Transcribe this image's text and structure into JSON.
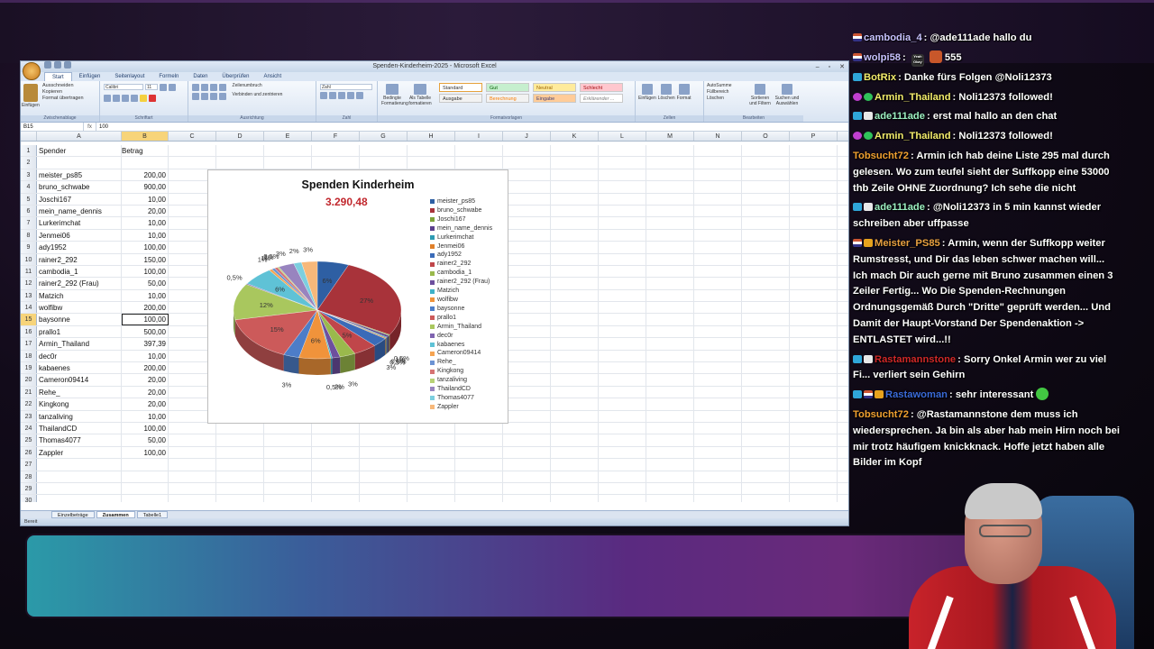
{
  "excel": {
    "window_title": "Spenden-Kinderheim-2025 - Microsoft Excel",
    "tabs": [
      "Start",
      "Einfügen",
      "Seitenlayout",
      "Formeln",
      "Daten",
      "Überprüfen",
      "Ansicht"
    ],
    "ribbon": {
      "paste": "Einfügen",
      "cut": "Ausschneiden",
      "copy": "Kopieren",
      "format_painter": "Format übertragen",
      "font": "Calibri",
      "font_size": "11",
      "wrap": "Zeilenumbruch",
      "merge": "Verbinden und zentrieren",
      "number_format": "Zahl",
      "cond_format": "Bedingte Formatierung",
      "as_table": "Als Tabelle formatieren",
      "groups": [
        "Zwischenablage",
        "Schriftart",
        "Ausrichtung",
        "Zahl",
        "Formatvorlagen",
        "Zellen",
        "Bearbeiten"
      ],
      "styles": [
        "Standard",
        "Gut",
        "Neutral",
        "Schlecht",
        "Ausgabe",
        "Berechnung",
        "Eingabe",
        "Erklärender ..."
      ],
      "cells": [
        "Einfügen",
        "Löschen",
        "Format"
      ],
      "editing": [
        "AutoSumme",
        "Füllbereich",
        "Löschen",
        "Sortieren und Filtern",
        "Suchen und Auswählen"
      ]
    },
    "name_box": "B15",
    "formula_value": "100",
    "columns": [
      "A",
      "B",
      "C",
      "D",
      "E",
      "F",
      "G",
      "H",
      "I",
      "J",
      "K",
      "L",
      "M",
      "N",
      "O",
      "P"
    ],
    "headers": {
      "a": "Spender",
      "b": "Betrag"
    },
    "rows": [
      {
        "n": "1",
        "a": "Spender",
        "b": "Betrag"
      },
      {
        "n": "2",
        "a": "",
        "b": ""
      },
      {
        "n": "3",
        "a": "meister_ps85",
        "b": "200,00"
      },
      {
        "n": "4",
        "a": "bruno_schwabe",
        "b": "900,00"
      },
      {
        "n": "5",
        "a": "Joschi167",
        "b": "10,00"
      },
      {
        "n": "6",
        "a": "mein_name_dennis",
        "b": "20,00"
      },
      {
        "n": "7",
        "a": "Lurkerimchat",
        "b": "10,00"
      },
      {
        "n": "8",
        "a": "Jenmei06",
        "b": "10,00"
      },
      {
        "n": "9",
        "a": "ady1952",
        "b": "100,00"
      },
      {
        "n": "10",
        "a": "rainer2_292",
        "b": "150,00"
      },
      {
        "n": "11",
        "a": "cambodia_1",
        "b": "100,00"
      },
      {
        "n": "12",
        "a": "rainer2_292 (Frau)",
        "b": "50,00"
      },
      {
        "n": "13",
        "a": "Matzich",
        "b": "10,00"
      },
      {
        "n": "14",
        "a": "wolfibw",
        "b": "200,00"
      },
      {
        "n": "15",
        "a": "baysonne",
        "b": "100,00"
      },
      {
        "n": "16",
        "a": "prallo1",
        "b": "500,00"
      },
      {
        "n": "17",
        "a": "Armin_Thailand",
        "b": "397,39"
      },
      {
        "n": "18",
        "a": "dec0r",
        "b": "10,00"
      },
      {
        "n": "19",
        "a": "kabaenes",
        "b": "200,00"
      },
      {
        "n": "20",
        "a": "Cameron09414",
        "b": "20,00"
      },
      {
        "n": "21",
        "a": "Rehe_",
        "b": "20,00"
      },
      {
        "n": "22",
        "a": "Kingkong",
        "b": "20,00"
      },
      {
        "n": "23",
        "a": "tanzaliving",
        "b": "10,00"
      },
      {
        "n": "24",
        "a": "ThailandCD",
        "b": "100,00"
      },
      {
        "n": "25",
        "a": "Thomas4077",
        "b": "50,00"
      },
      {
        "n": "26",
        "a": "Zappler",
        "b": "100,00"
      },
      {
        "n": "27",
        "a": "",
        "b": ""
      },
      {
        "n": "28",
        "a": "",
        "b": ""
      },
      {
        "n": "29",
        "a": "",
        "b": ""
      },
      {
        "n": "30",
        "a": "",
        "b": ""
      }
    ],
    "sheet_tabs": [
      "Einzelbeträge",
      "Zusammen",
      "Tabelle1"
    ],
    "status": "Bereit"
  },
  "chart_data": {
    "type": "pie",
    "title": "Spenden Kinderheim",
    "subtitle": "3.290,48",
    "categories": [
      "meister_ps85",
      "bruno_schwabe",
      "Joschi167",
      "mein_name_dennis",
      "Lurkerimchat",
      "Jenmei06",
      "ady1952",
      "rainer2_292",
      "cambodia_1",
      "rainer2_292 (Frau)",
      "Matzich",
      "wolfibw",
      "baysonne",
      "prallo1",
      "Armin_Thailand",
      "dec0r",
      "kabaenes",
      "Cameron09414",
      "Rehe_",
      "Kingkong",
      "tanzaliving",
      "ThailandCD",
      "Thomas4077",
      "Zappler"
    ],
    "values": [
      200,
      900,
      10,
      20,
      10,
      10,
      100,
      150,
      100,
      50,
      10,
      200,
      100,
      500,
      397.39,
      10,
      200,
      20,
      20,
      20,
      10,
      100,
      50,
      100
    ],
    "colors": [
      "#2e5fa3",
      "#a8333a",
      "#7ea33a",
      "#5b3f8c",
      "#2d9bb3",
      "#e07f2a",
      "#3a6bb8",
      "#c0464a",
      "#9ab94c",
      "#6d4f9e",
      "#3fb2c9",
      "#f0933b",
      "#4d7dc8",
      "#cc5a5a",
      "#a9c75e",
      "#7f64b0",
      "#5fc2d6",
      "#f6a452",
      "#6c93d3",
      "#d67373",
      "#b8d276",
      "#9884bf",
      "#7ccfdf",
      "#f7b87a"
    ],
    "labels": [
      "6%",
      "27%",
      "0,5%",
      "1%",
      "0,5%",
      "0,5%",
      "3%",
      "5%",
      "3%",
      "2%",
      "0,5%",
      "6%",
      "3%",
      "15%",
      "12%",
      "0,5%",
      "6%",
      "1%",
      "1%",
      "1%",
      "0,5%",
      "3%",
      "2%",
      "3%"
    ],
    "legend": "right"
  },
  "chat": [
    {
      "name": "cambodia_4",
      "color": "#c8c2ff",
      "badges": [
        "b-flag"
      ],
      "text": "@ade111ade hallo du"
    },
    {
      "name": "wolpi58",
      "color": "#c8c2ff",
      "badges": [
        "b-flag"
      ],
      "text": "555",
      "emote": "Yeah Okay"
    },
    {
      "name": "BotRix",
      "color": "#f3ec6c",
      "badges": [
        "b-mod"
      ],
      "text": "Danke fürs Folgen @Noli12373"
    },
    {
      "name": "Armin_Thailand",
      "color": "#f3ec6c",
      "badges": [
        "b-vip",
        "b-check"
      ],
      "text": "Noli12373 followed!"
    },
    {
      "name": "ade111ade",
      "color": "#9cf0c2",
      "badges": [
        "b-mod",
        "b-sub"
      ],
      "text": "erst mal hallo an den chat"
    },
    {
      "name": "Armin_Thailand",
      "color": "#f3ec6c",
      "badges": [
        "b-vip",
        "b-check"
      ],
      "text": "Noli12373 followed!"
    },
    {
      "name": "Tobsucht72",
      "color": "#f0a030",
      "badges": [],
      "text": "Armin ich hab deine Liste 295 mal durch gelesen. Wo zum teufel sieht der Suffkopp eine 53000 thb Zeile OHNE Zuordnung? Ich sehe die nicht"
    },
    {
      "name": "ade111ade",
      "color": "#9cf0c2",
      "badges": [
        "b-mod",
        "b-sub"
      ],
      "text": "@Noli12373 in 5 min kannst wieder schreiben aber uffpasse"
    },
    {
      "name": "Meister_PS85",
      "color": "#e8a040",
      "badges": [
        "b-flag",
        "b-gift"
      ],
      "text": "Armin, wenn der Suffkopp weiter Rumstresst, und Dir das leben schwer machen will... Ich mach Dir auch gerne mit Bruno zusammen einen 3 Zeiler Fertig... Wo Die Spenden-Rechnungen Ordnungsgemäß Durch \"Dritte\" geprüft werden... Und Damit der Haupt-Vorstand Der Spendenaktion -> ENTLASTET wird...!!"
    },
    {
      "name": "Rastamannstone",
      "color": "#d02828",
      "badges": [
        "b-mod",
        "b-sub"
      ],
      "text": "Sorry Onkel Armin wer zu viel Fi... verliert sein Gehirn"
    },
    {
      "name": "Rastawoman",
      "color": "#3a6ad8",
      "badges": [
        "b-mod",
        "b-flag",
        "b-gift"
      ],
      "text": "sehr interessant"
    },
    {
      "name": "Tobsucht72",
      "color": "#f0a030",
      "badges": [],
      "text": "@Rastamannstone dem muss ich wiedersprechen. Ja bin als aber hab mein Hirn noch bei mir trotz häufigem knickknack. Hoffe jetzt haben alle Bilder im Kopf"
    }
  ]
}
